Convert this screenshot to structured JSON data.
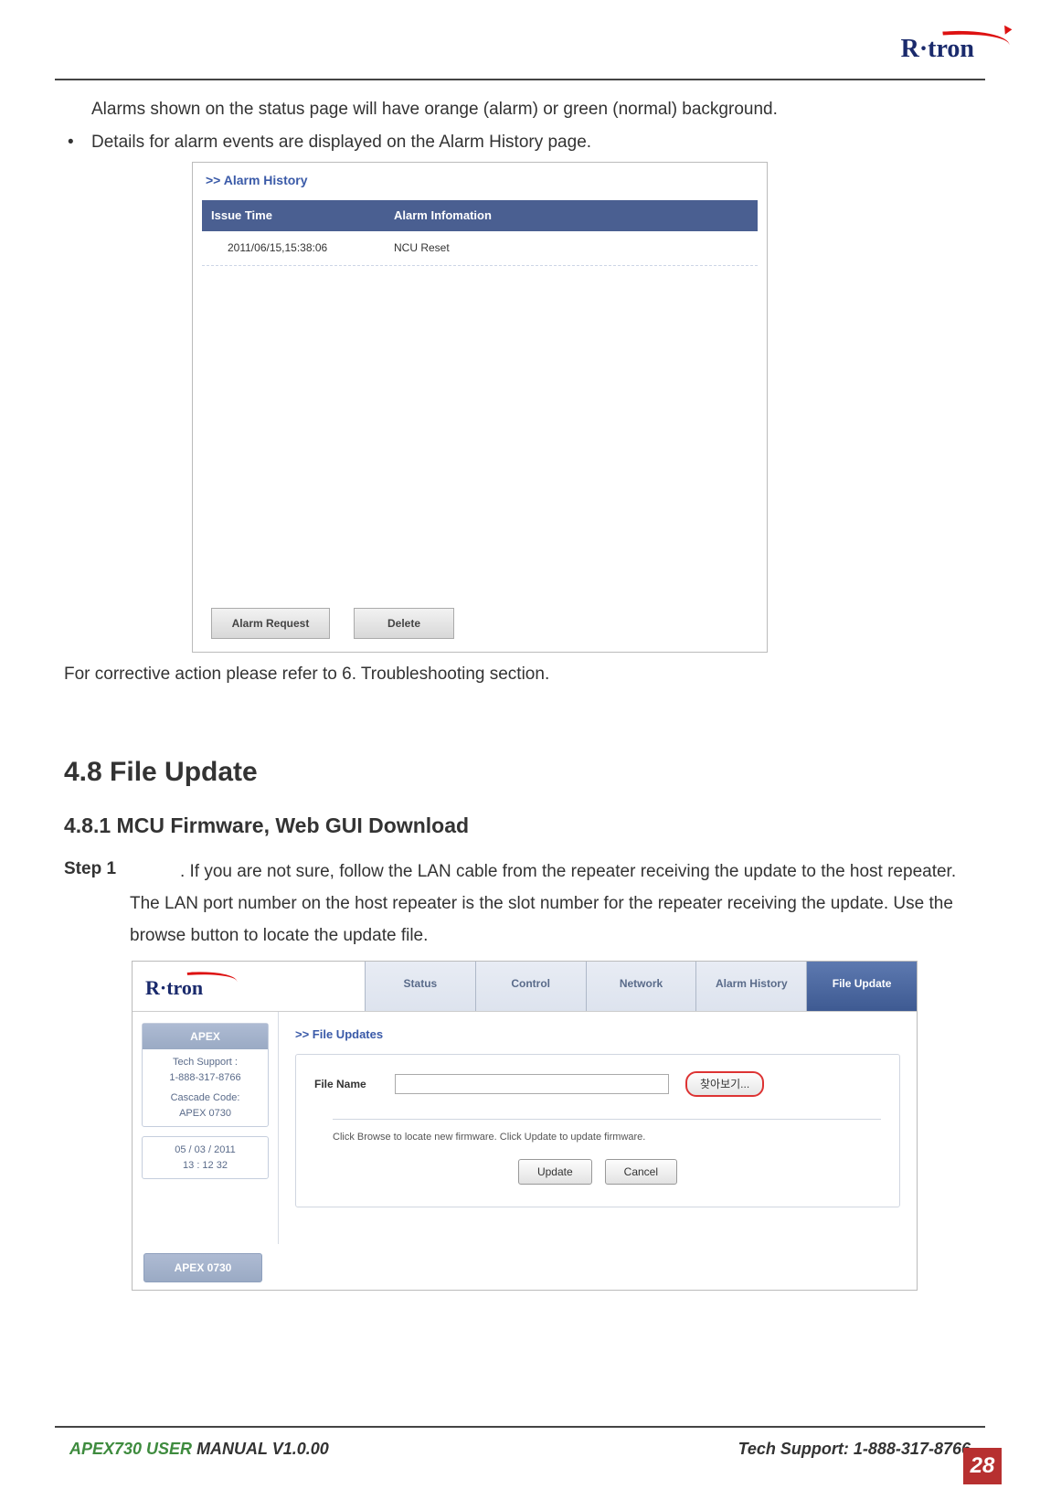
{
  "brand": "R·tron",
  "para1": "Alarms shown on the status page will have orange (alarm) or green (normal) background.",
  "bullet1": "Details for alarm events are displayed on the Alarm History page.",
  "alarm_history": {
    "box_title": ">> Alarm History",
    "col_issue_time": "Issue Time",
    "col_alarm_info": "Alarm Infomation",
    "row1_time": "2011/06/15,15:38:06",
    "row1_info": "NCU Reset",
    "btn_alarm_request": "Alarm Request",
    "btn_delete": "Delete"
  },
  "para2": "For corrective action please refer to 6. Troubleshooting section.",
  "section_h": "4.8   File Update",
  "sub_h": "4.8.1  MCU Firmware, Web GUI Download",
  "step1_label": "Step 1",
  "step1_body": ". If you are not sure, follow the LAN cable from the repeater receiving the update to the host repeater. The LAN port number on the host repeater is the slot number for the repeater receiving the update. Use the browse button to locate the update file.",
  "file_update": {
    "tabs": {
      "status": "Status",
      "control": "Control",
      "network": "Network",
      "alarm_history": "Alarm History",
      "file_update": "File Update"
    },
    "side": {
      "apex_hdr": "APEX",
      "tech_label": "Tech Support :",
      "tech_phone": "1-888-317-8766",
      "cascade_label": "Cascade Code:",
      "cascade_code": "APEX 0730",
      "date": "05 /   03 /    2011",
      "time": "13 :    12       32",
      "footer_tab": "APEX 0730"
    },
    "main": {
      "sec_title": ">> File Updates",
      "file_name_label": "File Name",
      "browse_label": "찾아보기...",
      "hint": "Click Browse to locate new firmware. Click Update to update firmware.",
      "update_btn": "Update",
      "cancel_btn": "Cancel"
    }
  },
  "footer": {
    "left_accent": "APEX730 USER",
    "left_rest": " MANUAL V1.0.00",
    "right": "Tech Support: 1-888-317-8766",
    "page": "28"
  }
}
